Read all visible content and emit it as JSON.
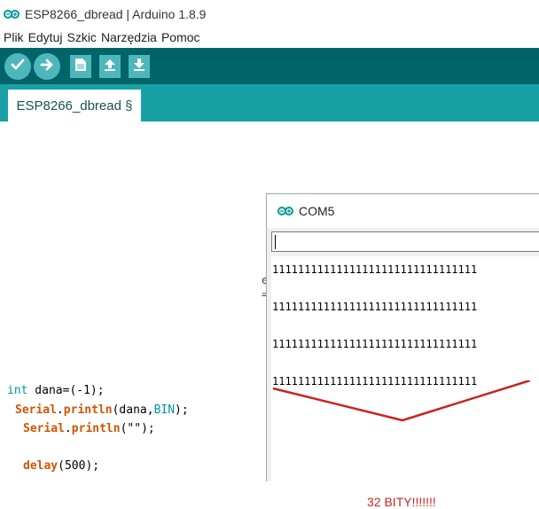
{
  "window": {
    "title": "ESP8266_dbread | Arduino 1.8.9"
  },
  "menu": [
    "Plik",
    "Edytuj",
    "Szkic",
    "Narzędzia",
    "Pomoc"
  ],
  "toolbar": {
    "verify_icon": "check-icon",
    "upload_icon": "arrow-right-icon",
    "new_icon": "document-icon",
    "open_icon": "arrow-up-icon",
    "save_icon": "arrow-down-icon"
  },
  "tab": {
    "label": "ESP8266_dbread §"
  },
  "code": {
    "line1_kw": "int",
    "line1_rest": " dana=(-1);",
    "line2_obj": "Serial",
    "line2_fn": "println",
    "line2_args_a": "(dana,",
    "line2_const": "BIN",
    "line2_args_b": ");",
    "line3_obj": "Serial",
    "line3_fn": "println",
    "line3_args": "(\"\");",
    "line4_fn": "delay",
    "line4_args": "(500);"
  },
  "serial_monitor": {
    "title": "COM5",
    "input_value": "",
    "output_lines": [
      "11111111111111111111111111111111",
      "11111111111111111111111111111111",
      "11111111111111111111111111111111",
      "11111111111111111111111111111111"
    ],
    "annotation": "32 BITY!!!!!!!",
    "annotation_color": "#cc2222"
  },
  "colors": {
    "toolbar_bg": "#006468",
    "tabbar_bg": "#17a1a5",
    "button_bg": "#4db7bb"
  }
}
